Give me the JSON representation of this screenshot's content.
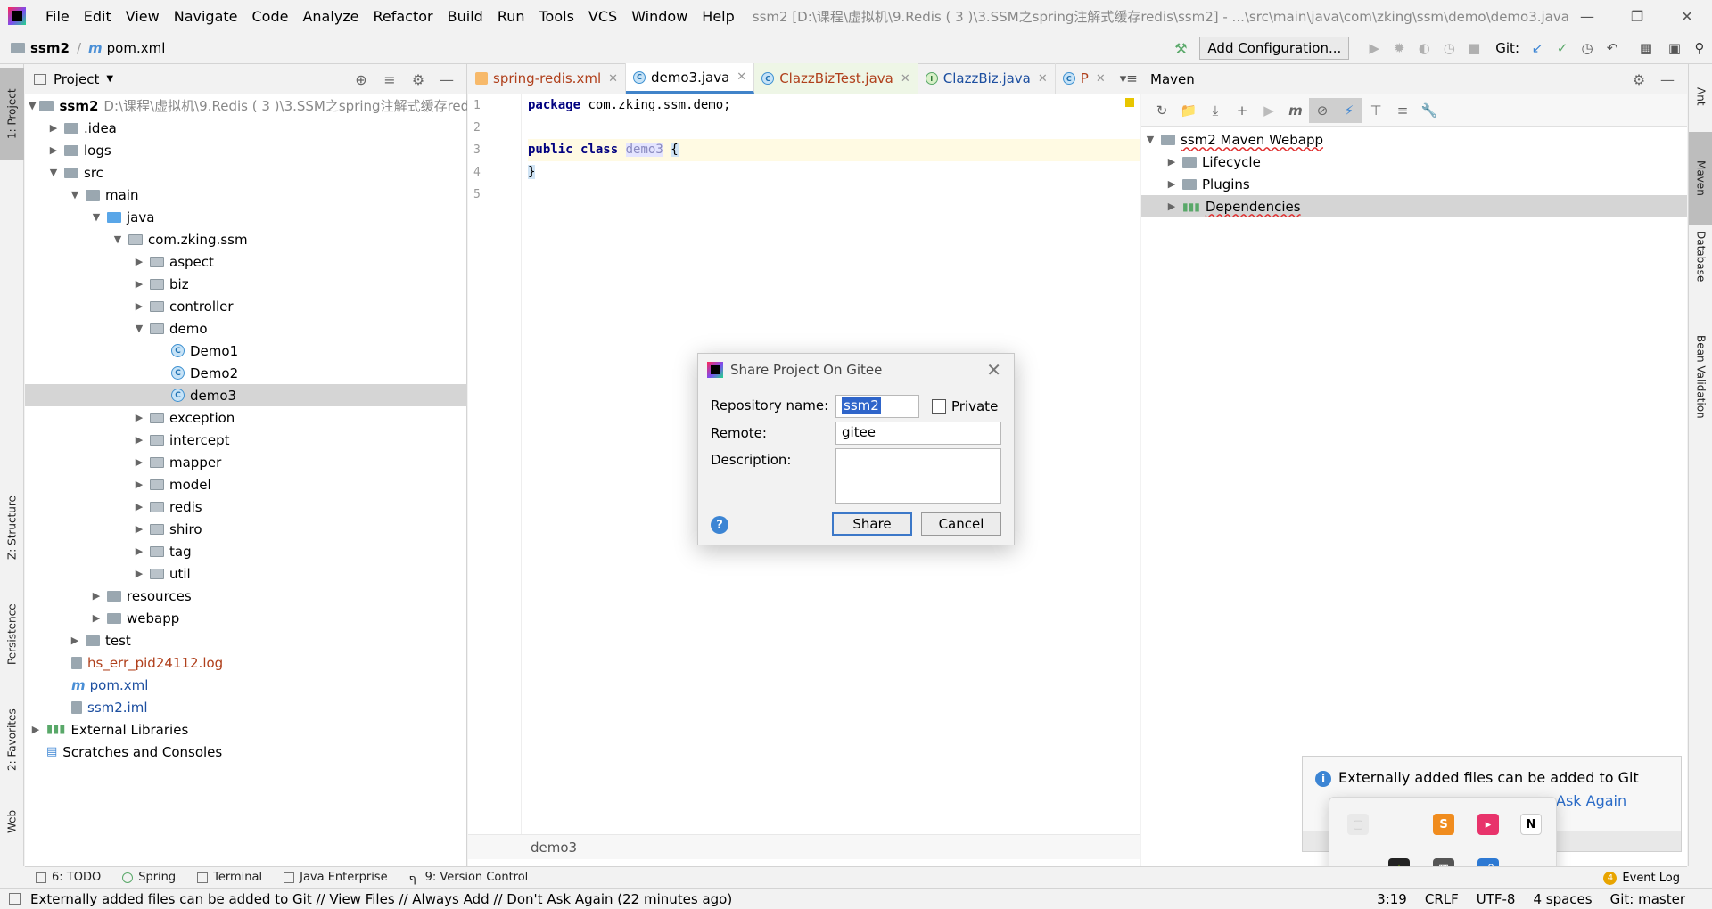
{
  "app": {
    "menu": [
      "File",
      "Edit",
      "View",
      "Navigate",
      "Code",
      "Analyze",
      "Refactor",
      "Build",
      "Run",
      "Tools",
      "VCS",
      "Window",
      "Help"
    ],
    "window_title": "ssm2 [D:\\课程\\虚拟机\\9.Redis ( 3 )\\3.SSM之spring注解式缓存redis\\ssm2] - ...\\src\\main\\java\\com\\zking\\ssm\\demo\\demo3.java"
  },
  "navbar": {
    "project": "ssm2",
    "file": "pom.xml",
    "add_configuration": "Add Configuration...",
    "git_label": "Git:"
  },
  "left_strip": {
    "project_tab": "1: Project",
    "structure_tab": "Z: Structure",
    "persistence_tab": "Persistence",
    "favorites_tab": "2: Favorites",
    "web_tab": "Web"
  },
  "right_strip": {
    "ant_tab": "Ant",
    "maven_tab": "Maven",
    "database_tab": "Database",
    "bean_tab": "Bean Validation"
  },
  "project_panel": {
    "title": "Project",
    "root_name": "ssm2",
    "root_path": "D:\\课程\\虚拟机\\9.Redis ( 3 )\\3.SSM之spring注解式缓存redis\\ssm2",
    "nodes": {
      "idea": ".idea",
      "logs": "logs",
      "src": "src",
      "main": "main",
      "java": "java",
      "pkg": "com.zking.ssm",
      "aspect": "aspect",
      "biz": "biz",
      "controller": "controller",
      "demo": "demo",
      "demo1": "Demo1",
      "demo2": "Demo2",
      "demo3": "demo3",
      "exception": "exception",
      "intercept": "intercept",
      "mapper": "mapper",
      "model": "model",
      "redis": "redis",
      "shiro": "shiro",
      "tag": "tag",
      "util": "util",
      "resources": "resources",
      "webapp": "webapp",
      "test": "test",
      "log": "hs_err_pid24112.log",
      "pom": "pom.xml",
      "iml": "ssm2.iml",
      "ext": "External Libraries",
      "scratches": "Scratches and Consoles"
    }
  },
  "editor": {
    "tabs": [
      "spring-redis.xml",
      "demo3.java",
      "ClazzBizTest.java",
      "ClazzBiz.java",
      "P"
    ],
    "lines": [
      "1",
      "2",
      "3",
      "4",
      "5"
    ],
    "code": {
      "l1_kw": "package",
      "l1_rest": " com.zking.ssm.demo;",
      "l3_kw1": "public",
      "l3_kw2": "class",
      "l3_name": "demo3",
      "l3_brace": "{",
      "l4_brace": "}"
    },
    "footer": "demo3"
  },
  "maven": {
    "title": "Maven",
    "root": "ssm2 Maven Webapp",
    "lifecycle": "Lifecycle",
    "plugins": "Plugins",
    "dependencies": "Dependencies"
  },
  "dialog": {
    "title": "Share Project On Gitee",
    "repo_label": "Repository name:",
    "repo_value": "ssm2",
    "private_label": "Private",
    "remote_label": "Remote:",
    "remote_value": "gitee",
    "description_label": "Description:",
    "share_button": "Share",
    "cancel_button": "Cancel"
  },
  "notification": {
    "text": "Externally added files can be added to Git",
    "link": "Ask Again"
  },
  "bottom_tools": {
    "todo": "6: TODO",
    "spring": "Spring",
    "terminal": "Terminal",
    "java_enterprise": "Java Enterprise",
    "vcs": "9: Version Control",
    "event_log": "Event Log",
    "event_count": "4"
  },
  "statusbar": {
    "message": "Externally added files can be added to Git // View Files // Always Add // Don't Ask Again (22 minutes ago)",
    "position": "3:19",
    "line_sep": "CRLF",
    "encoding": "UTF-8",
    "indent": "4 spaces",
    "branch": "Git: master"
  }
}
